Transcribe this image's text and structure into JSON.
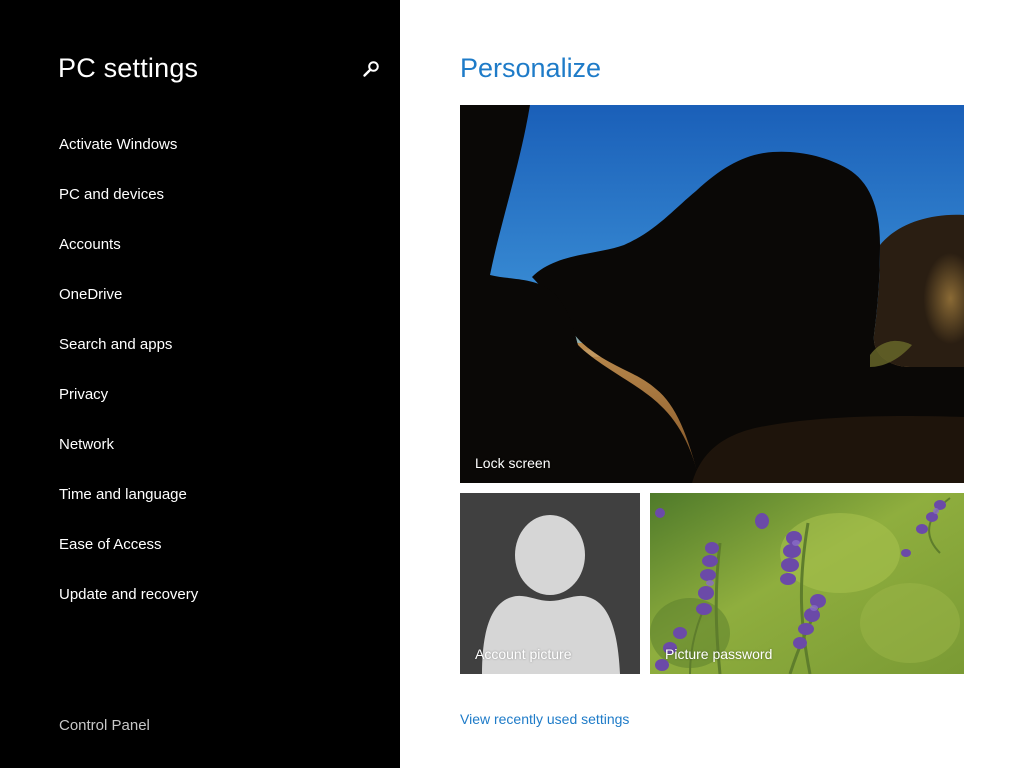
{
  "sidebar": {
    "title": "PC settings",
    "search_icon": "search-icon",
    "items": [
      {
        "label": "Activate Windows"
      },
      {
        "label": "PC and devices"
      },
      {
        "label": "Accounts"
      },
      {
        "label": "OneDrive"
      },
      {
        "label": "Search and apps"
      },
      {
        "label": "Privacy"
      },
      {
        "label": "Network"
      },
      {
        "label": "Time and language"
      },
      {
        "label": "Ease of Access"
      },
      {
        "label": "Update and recovery"
      }
    ],
    "footer_link": "Control Panel"
  },
  "main": {
    "title": "Personalize",
    "tiles": {
      "lock_screen": {
        "label": "Lock screen"
      },
      "account_picture": {
        "label": "Account picture"
      },
      "picture_password": {
        "label": "Picture password"
      }
    },
    "recent_link": "View recently used settings"
  },
  "colors": {
    "sidebar_bg": "#000000",
    "accent": "#1e7bc8",
    "account_tile_bg": "#404040"
  }
}
